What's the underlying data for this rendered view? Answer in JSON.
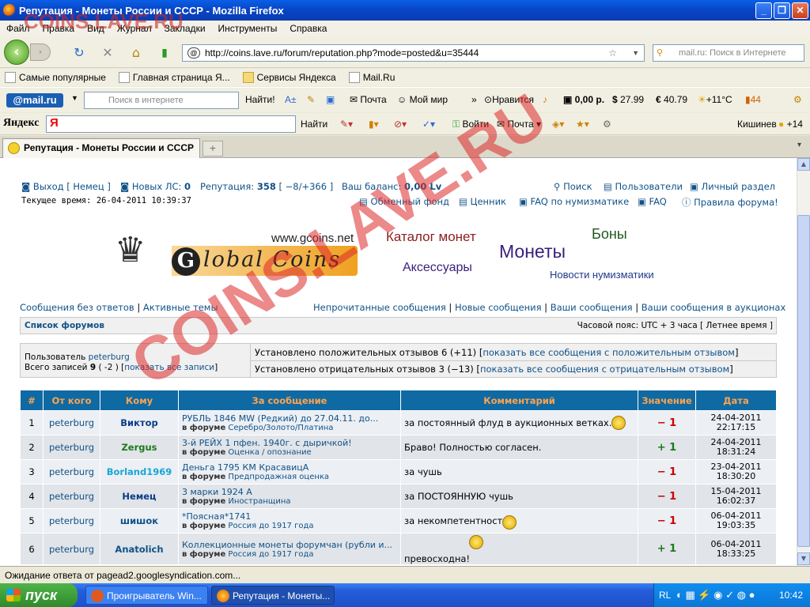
{
  "window": {
    "title": "Репутация - Монеты России и СССР - Mozilla Firefox"
  },
  "menu": [
    "Файл",
    "Правка",
    "Вид",
    "Журнал",
    "Закладки",
    "Инструменты",
    "Справка"
  ],
  "nav": {
    "url": "http://coins.lave.ru/forum/reputation.php?mode=posted&u=35444",
    "search_placeholder": "mail.ru: Поиск в Интернете"
  },
  "bookmarks": [
    "Самые популярные",
    "Главная страница Я...",
    "Сервисы Яндекса",
    "Mail.Ru"
  ],
  "mailbar": {
    "logo": "@mail.ru",
    "search_placeholder": "Поиск в интернете",
    "find": "Найти!",
    "mail": "Почта",
    "myworld": "Мой мир",
    "like": "Нравится",
    "money": "0,00 р.",
    "usd": "27.99",
    "eur": "40.79",
    "weather": "+11°C",
    "count": "44"
  },
  "yabar": {
    "logo": "Яндекс",
    "find": "Найти",
    "login": "Войти",
    "mail": "Почта",
    "city": "Кишинев",
    "temp": "+14"
  },
  "tab": {
    "title": "Репутация - Монеты России и СССР"
  },
  "header": {
    "logout": "Выход [ Немец ]",
    "new_pm_label": "Новых ЛС:",
    "new_pm": "0",
    "rep_label": "Репутация:",
    "rep": "358",
    "rep_detail": "[ −8/+366 ]",
    "balance_label": "Ваш баланс:",
    "balance": "0,00 Lv",
    "time": "Текущее время: 26-04-2011 10:39:37",
    "search": "Поиск",
    "users": "Пользователи",
    "personal": "Личный раздел",
    "exchange": "Обменный фонд",
    "prices": "Ценник",
    "faq_num": "FAQ по нумизматике",
    "faq": "FAQ",
    "rules": "Правила форума!"
  },
  "banner": {
    "site": "www.gcoins.net",
    "brand_g": "G",
    "brand": "lobal Coins",
    "catalog": "Каталог монет",
    "bonds": "Боны",
    "coins": "Монеты",
    "accessories": "Аксессуары",
    "news": "Новости нумизматики"
  },
  "links": {
    "no_answers": "Сообщения без ответов",
    "active": "Активные темы",
    "unread": "Непрочитанные сообщения",
    "new": "Новые сообщения",
    "yours": "Ваши сообщения",
    "auctions": "Ваши сообщения в аукционах",
    "sep": "|"
  },
  "forumbar": {
    "list": "Список форумов",
    "tz": "Часовой пояс: UTC + 3 часа [ Летнее время ]"
  },
  "userbox": {
    "user_label": "Пользователь",
    "user": "peterburg",
    "posts_label": "Всего записей",
    "posts": "9",
    "posts_detail": "( -2 ) [",
    "show_posts": "показать все записи",
    "close": "]",
    "positive": "Установлено положительных отзывов 6 (+11) [",
    "show_positive": "показать все сообщения с положительным отзывом",
    "negative": "Установлено отрицательных отзывов 3 (−13) [",
    "show_negative": "показать все сообщения с отрицательным отзывом"
  },
  "table": {
    "headers": [
      "#",
      "От кого",
      "Кому",
      "За сообщение",
      "Комментарий",
      "Значение",
      "Дата"
    ],
    "forum_prefix": "в форуме",
    "rows": [
      {
        "n": "1",
        "from": "peterburg",
        "to": "Виктор",
        "to_color": "#0b3c8a",
        "topic": "РУБЛЬ 1846 MW (Редкий) до 27.04.11. до...",
        "forum": "Серебро/Золото/Платина",
        "comment": "за постоянный флуд в аукционных ветках.",
        "value": "− 1",
        "value_color": "#cc0000",
        "date": "24-04-2011",
        "time": "22:17:15"
      },
      {
        "n": "2",
        "from": "peterburg",
        "to": "Zergus",
        "to_color": "#1d7a1d",
        "topic": "3-й РЕЙХ 1 пфен. 1940г. с дыричкой!",
        "forum": "Оценка / опознание",
        "comment": "Браво! Полностью согласен.",
        "value": "+ 1",
        "value_color": "#1d7a1d",
        "date": "24-04-2011",
        "time": "18:31:24"
      },
      {
        "n": "3",
        "from": "peterburg",
        "to": "Borland1969",
        "to_color": "#17a6d6",
        "topic": "Деньга 1795 КМ КрасавицА",
        "forum": "Предпродажная оценка",
        "comment": "за чушь",
        "value": "− 1",
        "value_color": "#cc0000",
        "date": "23-04-2011",
        "time": "18:30:20"
      },
      {
        "n": "4",
        "from": "peterburg",
        "to": "Немец",
        "to_color": "#0b3c8a",
        "topic": "3 марки 1924 А",
        "forum": "Иностранщина",
        "comment": "за ПОСТОЯННУЮ чушь",
        "value": "− 1",
        "value_color": "#cc0000",
        "date": "15-04-2011",
        "time": "16:02:37"
      },
      {
        "n": "5",
        "from": "peterburg",
        "to": "шишок",
        "to_color": "#105289",
        "topic": "*Поясная*1741",
        "forum": "Россия до 1917 года",
        "comment": "за некомпетентность",
        "value": "− 1",
        "value_color": "#cc0000",
        "date": "06-04-2011",
        "time": "19:03:35"
      },
      {
        "n": "6",
        "from": "peterburg",
        "to": "Anatolich",
        "to_color": "#105289",
        "topic": "Коллекционные монеты форумчан (рубли и...",
        "forum": "Россия до 1917 года",
        "comment": "превосходна!",
        "value": "+ 1",
        "value_color": "#1d7a1d",
        "date": "06-04-2011",
        "time": "18:33:25"
      }
    ]
  },
  "status": "Ожидание ответа от pagead2.googlesyndication.com...",
  "taskbar": {
    "start": "пуск",
    "task1": "Проигрыватель Win...",
    "task2": "Репутация - Монеты...",
    "lang": "RL",
    "clock": "10:42"
  },
  "watermark": {
    "top": "COINS.LAVE.RU",
    "diag": "COINS.LAVE.RU"
  }
}
